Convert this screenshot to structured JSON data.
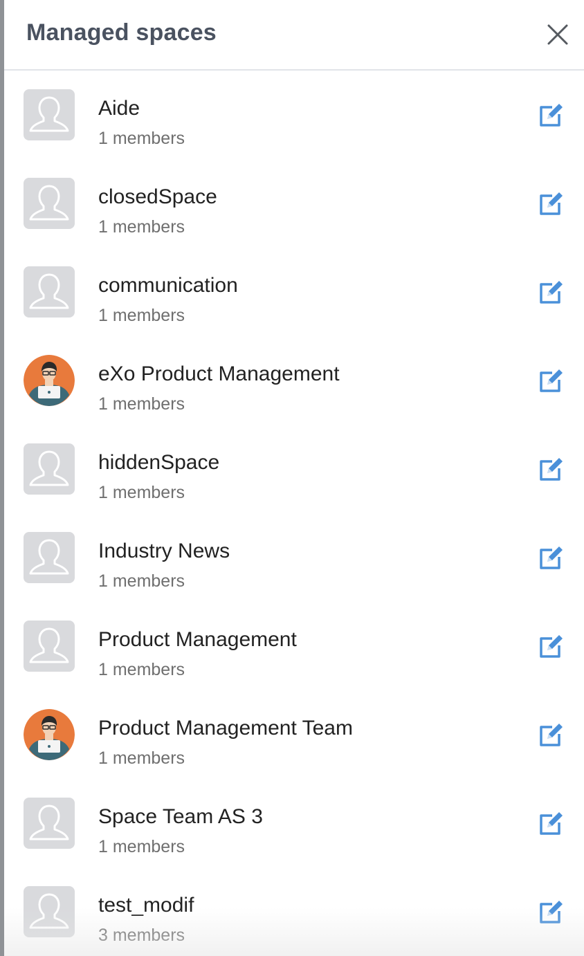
{
  "drawer": {
    "title": "Managed spaces",
    "close_icon": "close-icon"
  },
  "colors": {
    "title": "#4a5260",
    "edit_icon": "#4a90d9",
    "default_avatar_bg": "#d9dadd",
    "user_avatar_bg": "#e87a3c"
  },
  "spaces": [
    {
      "name": "Aide",
      "members": "1 members",
      "avatar": "default-space-avatar",
      "edit_icon": "edit-icon"
    },
    {
      "name": "closedSpace",
      "members": "1 members",
      "avatar": "default-space-avatar",
      "edit_icon": "edit-icon"
    },
    {
      "name": "communication",
      "members": "1 members",
      "avatar": "default-space-avatar",
      "edit_icon": "edit-icon"
    },
    {
      "name": "eXo Product Management",
      "members": "1 members",
      "avatar": "person-laptop-avatar",
      "edit_icon": "edit-icon"
    },
    {
      "name": "hiddenSpace",
      "members": "1 members",
      "avatar": "default-space-avatar",
      "edit_icon": "edit-icon"
    },
    {
      "name": "Industry News",
      "members": "1 members",
      "avatar": "default-space-avatar",
      "edit_icon": "edit-icon"
    },
    {
      "name": "Product Management",
      "members": "1 members",
      "avatar": "default-space-avatar",
      "edit_icon": "edit-icon"
    },
    {
      "name": "Product Management Team",
      "members": "1 members",
      "avatar": "person-laptop-avatar",
      "edit_icon": "edit-icon"
    },
    {
      "name": "Space Team AS 3",
      "members": "1 members",
      "avatar": "default-space-avatar",
      "edit_icon": "edit-icon"
    },
    {
      "name": "test_modif",
      "members": "3 members",
      "avatar": "default-space-avatar",
      "edit_icon": "edit-icon"
    }
  ]
}
